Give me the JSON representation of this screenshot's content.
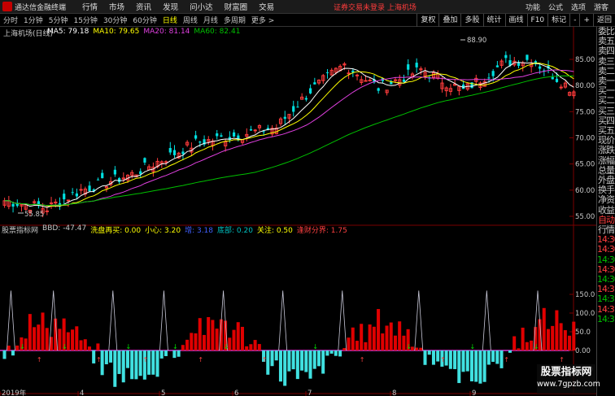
{
  "app": {
    "title": "通达信金融终端"
  },
  "menu": [
    "行情",
    "市场",
    "资讯",
    "发现",
    "问小达",
    "财富圈",
    "交易"
  ],
  "notice": "证券交易未登录  上海机场",
  "top_right": [
    "功能",
    "公式",
    "选项",
    "游客"
  ],
  "periods": [
    "分时",
    "1分钟",
    "5分钟",
    "15分钟",
    "30分钟",
    "60分钟",
    "日线",
    "周线",
    "月线",
    "多周期",
    "更多 >"
  ],
  "active_period": "日线",
  "tools": [
    "复权",
    "叠加",
    "多股",
    "统计",
    "画线",
    "F10",
    "标记",
    "-",
    "+",
    "返回"
  ],
  "stock": {
    "title": "上海机场(日线)"
  },
  "ma": [
    {
      "label": "MA5: 79.18",
      "color": "#ffffff"
    },
    {
      "label": "MA10: 79.65",
      "color": "#ffff00"
    },
    {
      "label": "MA20: 81.14",
      "color": "#e040e0"
    },
    {
      "label": "MA60: 82.41",
      "color": "#00c000"
    }
  ],
  "indicator": {
    "name": "股票指标网",
    "items": [
      {
        "label": "BBD: -47.47",
        "color": "#c8c8c8"
      },
      {
        "label": "洗盘再买: 0.00",
        "color": "#ffff00"
      },
      {
        "label": "小心: 3.20",
        "color": "#ffff00"
      },
      {
        "label": "增: 3.18",
        "color": "#4060ff"
      },
      {
        "label": "底部: 0.20",
        "color": "#00c0c0"
      },
      {
        "label": "关注: 0.50",
        "color": "#ffff00"
      },
      {
        "label": "逢财分界: 1.75",
        "color": "#ff4040"
      }
    ]
  },
  "right_panel": [
    "委比",
    "卖五",
    "卖四",
    "卖三",
    "卖二",
    "卖一",
    "买一",
    "买二",
    "买三",
    "买四",
    "买五",
    "现价",
    "涨跌",
    "涨幅",
    "总量",
    "外盘",
    "换手",
    "净资",
    "收益",
    "自动",
    "行情",
    "14:30",
    "14:30",
    "14:30",
    "14:30",
    "14:30",
    "14:31",
    "14:31",
    "14:31",
    "14:31"
  ],
  "watermark": {
    "main": "股票指标网",
    "sub": "www.7gpzb.com"
  },
  "chart_data": {
    "type": "candlestick",
    "price_axis_ticks": [
      "85.00",
      "80.00",
      "75.00",
      "70.00",
      "65.00",
      "60.00",
      "55.00"
    ],
    "indicator_axis_ticks": [
      "150.0",
      "100.0",
      "50.0",
      "0.00",
      "-50.0"
    ],
    "x_tick_labels": [
      "2019年",
      "4",
      "5",
      "6",
      "7",
      "8",
      "9"
    ],
    "annotations": [
      "88.90",
      "55.85"
    ],
    "ma_labels": [
      "MA5",
      "MA10",
      "MA20",
      "MA60"
    ]
  }
}
